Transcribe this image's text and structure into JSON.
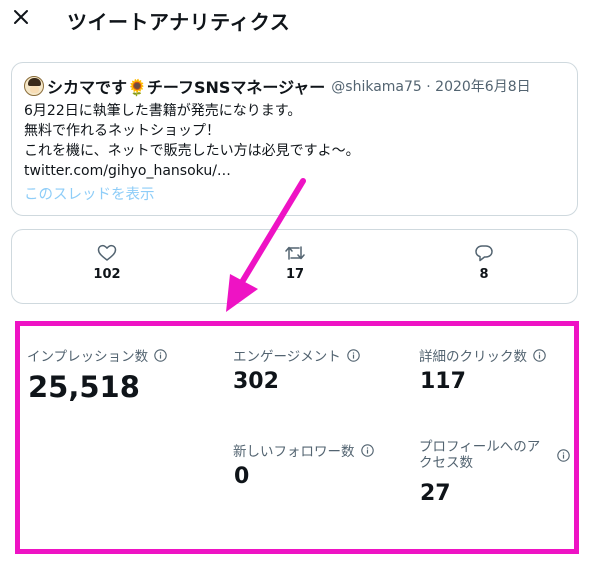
{
  "header": {
    "title": "ツイートアナリティクス"
  },
  "tweet": {
    "author_name": "シカマです🌻チーフSNSマネージャー",
    "handle_date": "@shikama75 · 2020年6月8日",
    "lines": [
      "6月22日に執筆した書籍が発売になります。",
      "無料で作れるネットショップ！",
      "これを機に、ネットで販売したい方は必見ですよ〜。",
      "twitter.com/gihyo_hansoku/…"
    ],
    "thread_link": "このスレッドを表示"
  },
  "engagement": {
    "likes": "102",
    "retweets": "17",
    "replies": "8"
  },
  "metrics": {
    "impressions": {
      "label": "インプレッション数",
      "value": "25,518"
    },
    "engagements": {
      "label": "エンゲージメント",
      "value": "302"
    },
    "detail_clicks": {
      "label": "詳細のクリック数",
      "value": "117"
    },
    "new_followers": {
      "label": "新しいフォロワー数",
      "value": "0"
    },
    "profile_visits": {
      "label_line1": "プロフィールへのア",
      "label_line2": "クセス数",
      "value": "27"
    }
  },
  "colors": {
    "highlight": "#ee13c4",
    "link": "#8ecdf8",
    "muted": "#536471",
    "border": "#cfd9de"
  },
  "icons": [
    "close-icon",
    "heart-icon",
    "retweet-icon",
    "reply-icon",
    "info-icon",
    "avatar",
    "arrow-annotation"
  ]
}
